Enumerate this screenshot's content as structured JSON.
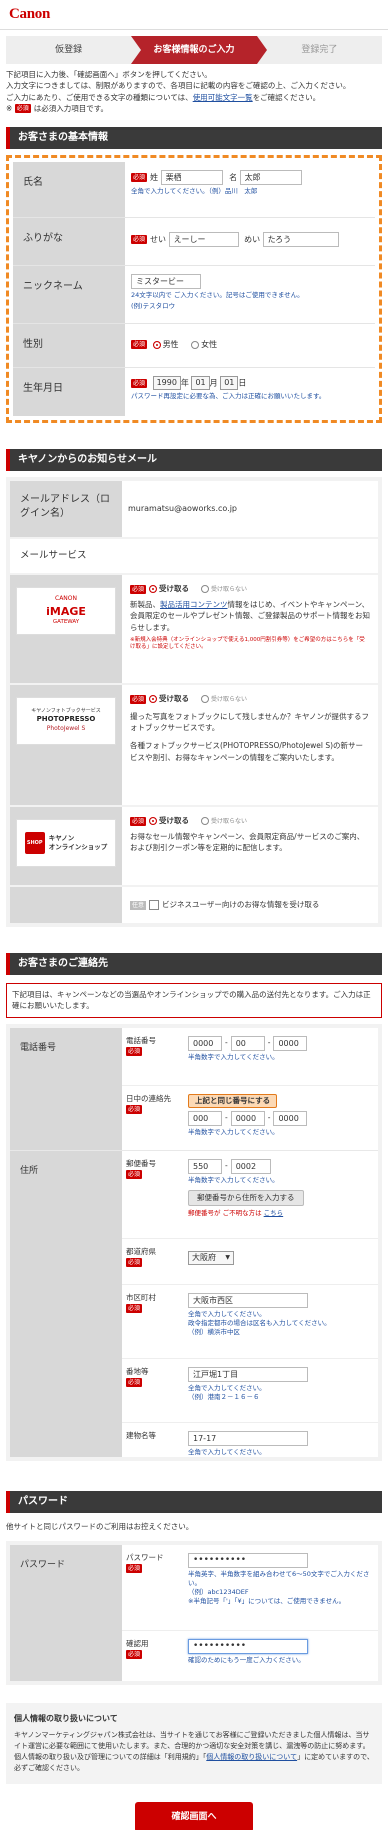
{
  "header": {
    "logo": "Canon"
  },
  "steps": [
    "仮登録",
    "お客様情報のご入力",
    "登録完了"
  ],
  "notes": {
    "line1": "下記項目に入力後、「確認画面へ」ボタンを押してください。",
    "line2": "入力文字につきましては、制限がありますので、各項目に記載の内容をご確認の上、ご入力ください。",
    "line3a": "ご入力にあたり、ご使用できる文字の種類については、",
    "line3link": "使用可能文字一覧",
    "line3b": "をご確認ください。",
    "mark": "※",
    "req_label": "必須",
    "line4": "は必須入力項目です。"
  },
  "basic": {
    "title": "お客さまの基本情報",
    "name_label": "氏名",
    "last_prefix": "姓",
    "last_value": "栗栖",
    "first_prefix": "名",
    "first_value": "太郎",
    "name_hint": "全角で入力してください。（例）品川　太郎",
    "kana_label": "ふりがな",
    "kana_last_prefix": "せい",
    "kana_last_value": "えーしー",
    "kana_first_prefix": "めい",
    "kana_first_value": "たろう",
    "nick_label": "ニックネーム",
    "nick_value": "ミスタービー",
    "nick_hint1": "24文字以内で ご入力ください。記号はご使用できません。",
    "nick_hint2": "(例)テスタロウ",
    "sex_label": "性別",
    "male": "男性",
    "female": "女性",
    "birth_label": "生年月日",
    "year": "1990",
    "year_unit": "年",
    "month": "01",
    "month_unit": "月",
    "day": "01",
    "day_unit": "日",
    "birth_hint": "パスワード再設定に必要な為、ご入力は正確にお願いいたします。"
  },
  "mail": {
    "title": "キヤノンからのお知らせメール",
    "email_label": "メールアドレス（ログイン名）",
    "email_value": "muramatsu@aoworks.co.jp",
    "service_label": "メールサービス",
    "accept": "受け取る",
    "decline": "受け取らない",
    "svc1_logo_top": "CANON",
    "svc1_logo_mid": "iMAGE",
    "svc1_logo_bot": "GATEWAY",
    "svc1_text_a": "新製品、",
    "svc1_link": "製品活用コンテンツ",
    "svc1_text_b": "情報をはじめ、イベントやキャンペーン、会員限定のセールやプレゼント情報、ご登録製品のサポート情報をお知らせします。",
    "svc1_small": "※新規入会特典（オンラインショップで使える1,000円割引券等）をご希望の方はこちらを「受け取る」に設定してください。",
    "svc2_logo_top": "キヤノンフォトブックサービス",
    "svc2_logo_mid": "PHOTOPRESSO",
    "svc2_logo_bot": "PhotoJewel S",
    "svc2_text1": "撮った写真をフォトブックにして残しませんか？キヤノンが提供するフォトブックサービスです。",
    "svc2_text2": "各種フォトブックサービス(PHOTOPRESSO/PhotoJewel S)の新サービスや割引、お得なキャンペーンの情報をご案内いたします。",
    "svc3_logo_mid": "キヤノン",
    "svc3_logo_bot": "オンラインショップ",
    "svc3_badge": "SHOP",
    "svc3_text": "お得なセール情報やキャンペーン、会員限定商品/サービスのご案内、および割引クーポン等を定期的に配信します。",
    "business_opt": "任意",
    "business_text": "ビジネスユーザー向けのお得な情報を受け取る"
  },
  "contact": {
    "title": "お客さまのご連絡先",
    "warning": "下記項目は、キャンペーンなどの当選品やオンラインショップでの購入品の送付先となります。ご入力は正確にお願いいたします。",
    "phone_group": "電話番号",
    "tel_label": "電話番号",
    "tel1": "0000",
    "tel2": "00",
    "tel3": "0000",
    "tel_hint": "半角数字で入力してください。",
    "day_label": "日中の連絡先",
    "same_btn": "上記と同じ番号にする",
    "day1": "000",
    "day2": "0000",
    "day3": "0000",
    "day_hint": "半角数字で入力してください。",
    "addr_group": "住所",
    "zip_label": "郵便番号",
    "zip1": "550",
    "zip2": "0002",
    "zip_hint": "半角数字で入力してください。",
    "zip_btn": "郵便番号から住所を入力する",
    "zip_unknown": "郵便番号が ご不明な方は",
    "zip_link": "こちら",
    "pref_label": "都道府県",
    "pref_value": "大阪府",
    "city_label": "市区町村",
    "city_value": "大阪市西区",
    "city_hint1": "全角で入力してください。",
    "city_hint2": "政令指定都市の場合は区名も入力してください。",
    "city_hint3": "（例）横浜市中区",
    "street_label": "番地等",
    "street_value": "江戸堀1丁目",
    "street_hint1": "全角で入力してください。",
    "street_hint2": "（例）港南２－１６－６",
    "bldg_label": "建物名等",
    "bldg_value": "17-17",
    "bldg_hint": "全角で入力してください。"
  },
  "password": {
    "title": "パスワード",
    "intro": "他サイトと同じパスワードのご利用はお控えください。",
    "group": "パスワード",
    "pw_label": "パスワード",
    "pw_value": "••••••••••",
    "pw_hint1": "半角英字、半角数字を組み合わせて6～50文字でご入力ください。",
    "pw_hint2": "（例）abc1234DEF",
    "pw_hint3": "※半角記号「'」「¥」については、ご使用できません。",
    "confirm_label": "確認用",
    "confirm_value": "••••••••••",
    "confirm_hint": "確認のためにもう一度ご入力ください。"
  },
  "privacy": {
    "title": "個人情報の取り扱いについて",
    "text_a": "キヤノンマーケティングジャパン株式会社は、当サイトを通じてお客様にご登録いただきました個人情報は、当サイト運営に必要な範囲にて使用いたします。",
    "text_b": "また、合理的かつ適切な安全対策を講じ、漏洩等の防止に努めます。個人情報の取り扱い及び管理についての詳細は「利用規約」「",
    "link": "個人情報の取り扱いについて",
    "text_c": "」に定めていますので、必ずご確認ください。"
  },
  "submit": "確認画面へ"
}
